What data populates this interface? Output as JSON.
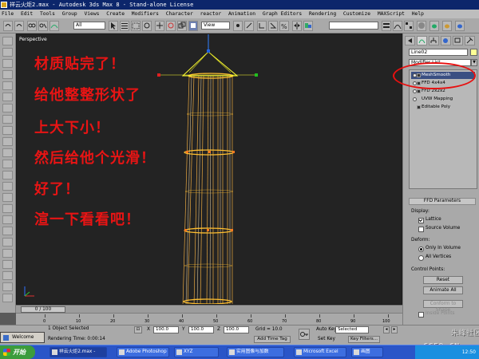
{
  "window": {
    "title": "祥云火炬2.max - Autodesk 3ds Max 8  - Stand-alone License"
  },
  "menu": [
    "File",
    "Edit",
    "Tools",
    "Group",
    "Views",
    "Create",
    "Modifiers",
    "Character",
    "reactor",
    "Animation",
    "Graph Editors",
    "Rendering",
    "Customize",
    "MAXScript",
    "Help"
  ],
  "toolbar": {
    "selection_filter": "All",
    "reference_coord": "View"
  },
  "viewport": {
    "label": "Perspective",
    "annotation_lines": [
      "材质贴完了！",
      "给他整整形状了",
      "上大下小！",
      "然后给他个光滑！",
      "好了！",
      "渲一下看看吧！"
    ],
    "annotation_color": "#e81414"
  },
  "command_panel": {
    "object_name": "Line02",
    "object_color": "#ffff96",
    "modifier_list_label": "Modifier List",
    "stack": [
      {
        "label": "MeshSmooth",
        "selected": true
      },
      {
        "label": "FFD 4x4x4",
        "selected": false
      },
      {
        "label": "FFD 2x2x2",
        "selected": false
      },
      {
        "label": "UVW Mapping",
        "selected": false
      },
      {
        "label": "Editable Poly",
        "selected": false
      }
    ],
    "rollout": {
      "title": "FFD Parameters",
      "display_label": "Display:",
      "lattice_label": "Lattice",
      "source_volume_label": "Source Volume",
      "deform_label": "Deform:",
      "only_in_volume_label": "Only In Volume",
      "all_vertices_label": "All Vertices",
      "control_points_label": "Control Points:",
      "reset_button": "Reset",
      "animate_all_button": "Animate All",
      "conform_to_shape_button": "Conform to Shape",
      "inside_points_label": "Inside Points"
    }
  },
  "timeline": {
    "slider_label": "0 / 100",
    "ticks": [
      "0",
      "10",
      "20",
      "30",
      "40",
      "50",
      "60",
      "70",
      "80",
      "90",
      "100"
    ]
  },
  "status": {
    "selection_text": "1 Object Selected",
    "render_time": "Rendering Time: 0:00:14",
    "x_value": "100.0",
    "y_value": "100.0",
    "z_value": "100.0",
    "grid": "Grid = 10.0",
    "add_time_tag": "Add Time Tag",
    "auto_key": "Auto Key",
    "set_key": "Set Key",
    "key_selected": "Selected",
    "key_filters": "Key Filters...",
    "popup_label": "Welcome"
  },
  "taskbar": {
    "start_label": "开始",
    "tasks": [
      {
        "label": "祥云火炬2.max -",
        "active": true
      },
      {
        "label": "Adobe Photoshop",
        "active": false
      },
      {
        "label": "XYZ",
        "active": false
      },
      {
        "label": "实用图像与加数",
        "active": false
      },
      {
        "label": "Microsoft Excel",
        "active": false
      },
      {
        "label": "画图",
        "active": false
      }
    ],
    "clock": "12:50"
  },
  "watermark": {
    "line1": "朱峰社区",
    "line2": "CG59.CN"
  }
}
